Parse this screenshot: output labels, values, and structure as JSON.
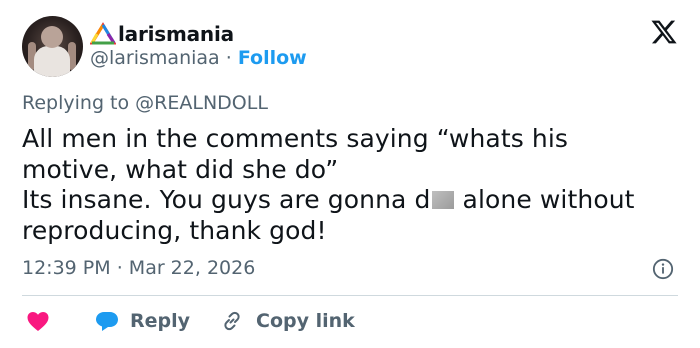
{
  "author": {
    "display_name": "larismania",
    "handle": "@larismaniaa",
    "separator": "·",
    "follow_label": "Follow"
  },
  "reply": {
    "prefix": "Replying to",
    "handle": "@REALNDOLL"
  },
  "tweet": {
    "line1": "All men in the comments saying “whats his",
    "line2": "motive, what did she do”",
    "line3_before": "Its insane. You guys are gonna d",
    "line3_after": " alone without",
    "line4": "reproducing, thank god!"
  },
  "meta": {
    "time": "12:39 PM",
    "separator": "·",
    "date": "Mar 22, 2026"
  },
  "actions": {
    "reply_label": "Reply",
    "copy_label": "Copy link"
  },
  "colors": {
    "link": "#1d9bf0",
    "heart": "#f91880",
    "muted": "#536471",
    "text": "#0f1419"
  },
  "icons": [
    "x-logo-icon",
    "info-icon",
    "heart-icon",
    "reply-bubble-icon",
    "link-icon",
    "rainbow-triangle-icon"
  ]
}
